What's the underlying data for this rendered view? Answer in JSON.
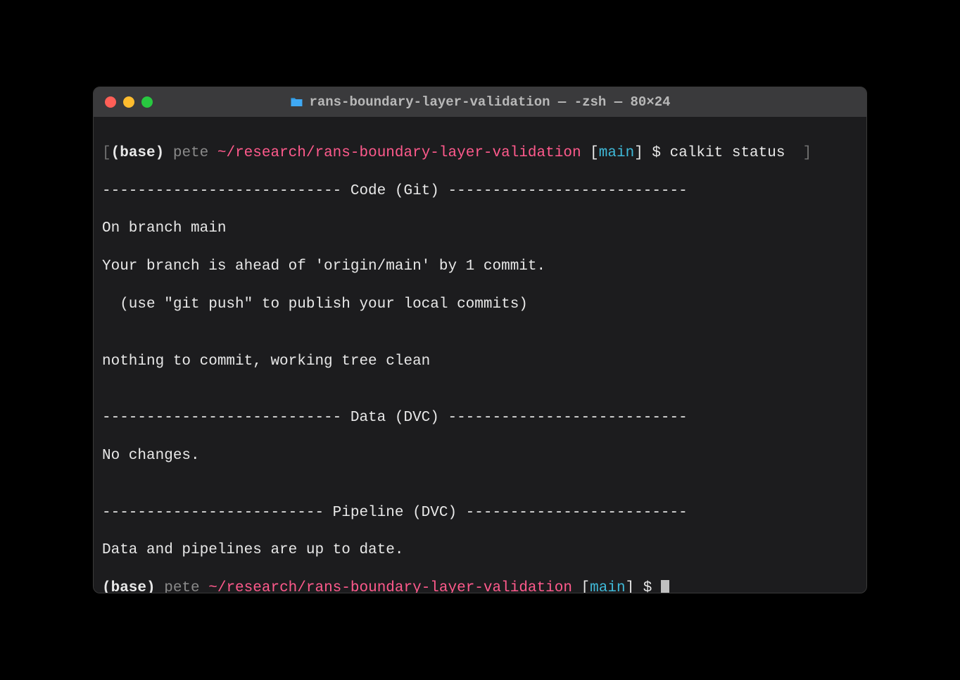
{
  "window": {
    "title": "rans-boundary-layer-validation — -zsh — 80×24"
  },
  "prompt1": {
    "edge_open": "[",
    "base": "(base)",
    "user": " pete ",
    "path": "~/research/rans-boundary-layer-validation",
    "bracket_open": " [",
    "branch": "main",
    "bracket_close": "] ",
    "dollar": "$ ",
    "command": "calkit status",
    "edge_close": "]"
  },
  "output": {
    "l1": "--------------------------- Code (Git) ---------------------------",
    "l2": "On branch main",
    "l3": "Your branch is ahead of 'origin/main' by 1 commit.",
    "l4": "  (use \"git push\" to publish your local commits)",
    "l5": "",
    "l6": "nothing to commit, working tree clean",
    "l7": "",
    "l8": "--------------------------- Data (DVC) ---------------------------",
    "l9": "No changes.",
    "l10": "",
    "l11": "------------------------- Pipeline (DVC) -------------------------",
    "l12": "Data and pipelines are up to date."
  },
  "prompt2": {
    "base": "(base)",
    "user": " pete ",
    "path": "~/research/rans-boundary-layer-validation",
    "bracket_open": " [",
    "branch": "main",
    "bracket_close": "] ",
    "dollar": "$ "
  }
}
